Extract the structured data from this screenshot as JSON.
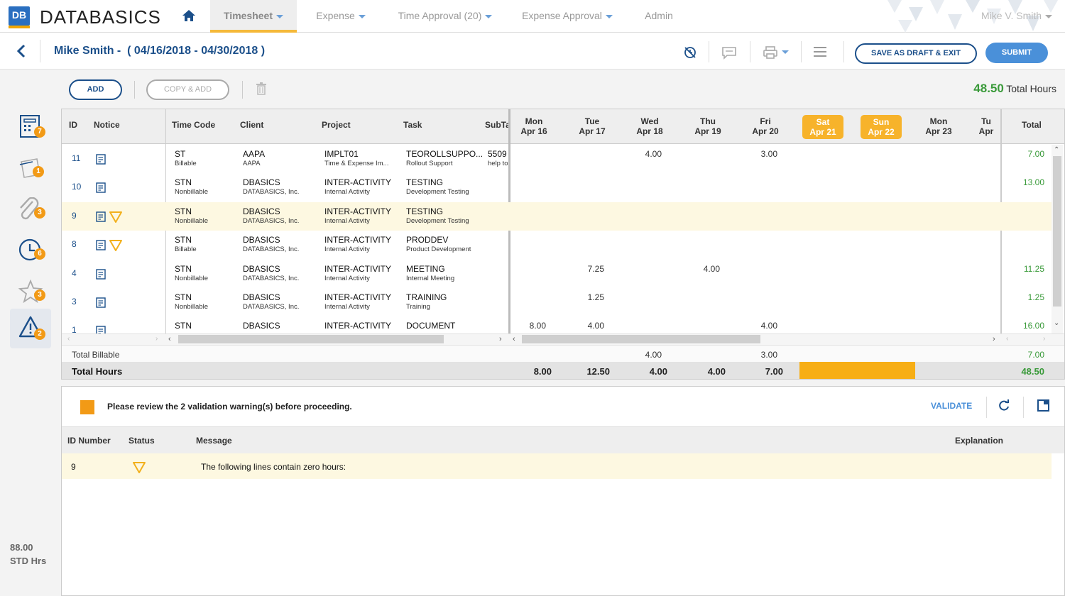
{
  "app": {
    "logo_mark": "DB",
    "logo_text": "DATABASICS"
  },
  "nav": {
    "items": [
      {
        "label": "Timesheet",
        "active": true,
        "dropdown": true
      },
      {
        "label": "Expense",
        "active": false,
        "dropdown": true
      },
      {
        "label": "Time Approval (20)",
        "active": false,
        "dropdown": true
      },
      {
        "label": "Expense Approval",
        "active": false,
        "dropdown": true
      },
      {
        "label": "Admin",
        "active": false,
        "dropdown": false
      }
    ],
    "user": "Mike V. Smith"
  },
  "header": {
    "employee": "Mike Smith -",
    "period": "( 04/16/2018 - 04/30/2018 )",
    "save_draft": "SAVE AS DRAFT & EXIT",
    "submit": "SUBMIT"
  },
  "toolbar": {
    "add": "ADD",
    "copy_add": "COPY & ADD",
    "total_hours_value": "48.50",
    "total_hours_label": "Total Hours"
  },
  "sidebar": {
    "items": [
      {
        "icon": "timesheet-icon",
        "badge": "7"
      },
      {
        "icon": "notes-icon",
        "badge": "1"
      },
      {
        "icon": "attachment-icon",
        "badge": "3"
      },
      {
        "icon": "clock-icon",
        "badge": "6"
      },
      {
        "icon": "star-icon",
        "badge": "3"
      },
      {
        "icon": "warning-icon",
        "badge": "2"
      }
    ],
    "std_hours": "88.00",
    "std_label": "STD Hrs"
  },
  "grid": {
    "left_headers": [
      "ID",
      "Notice"
    ],
    "mid_headers": [
      "Time Code",
      "Client",
      "Project",
      "Task",
      "SubTa"
    ],
    "days": [
      {
        "dow": "Mon",
        "date": "Apr 16",
        "weekend": false
      },
      {
        "dow": "Tue",
        "date": "Apr 17",
        "weekend": false
      },
      {
        "dow": "Wed",
        "date": "Apr 18",
        "weekend": false
      },
      {
        "dow": "Thu",
        "date": "Apr 19",
        "weekend": false
      },
      {
        "dow": "Fri",
        "date": "Apr 20",
        "weekend": false
      },
      {
        "dow": "Sat",
        "date": "Apr 21",
        "weekend": true
      },
      {
        "dow": "Sun",
        "date": "Apr 22",
        "weekend": true
      },
      {
        "dow": "Mon",
        "date": "Apr 23",
        "weekend": false
      },
      {
        "dow": "Tu",
        "date": "Apr",
        "weekend": false
      }
    ],
    "total_header": "Total",
    "rows": [
      {
        "id": "11",
        "warn": false,
        "hl": false,
        "tc": "ST",
        "tc_sub": "Billable",
        "client": "AAPA",
        "client_sub": "AAPA",
        "project": "IMPLT01",
        "project_sub": "Time & Expense Im...",
        "task": "TEOROLLSUPPO...",
        "task_sub": "Rollout Support",
        "subtask": "5509",
        "subtask_sub": "help to",
        "hours": [
          "",
          "",
          "4.00",
          "",
          "3.00",
          "",
          "",
          "",
          ""
        ],
        "total": "7.00"
      },
      {
        "id": "10",
        "warn": false,
        "hl": false,
        "tc": "STN",
        "tc_sub": "Nonbillable",
        "client": "DBASICS",
        "client_sub": "DATABASICS, Inc.",
        "project": "INTER-ACTIVITY",
        "project_sub": "Internal Activity",
        "task": "TESTING",
        "task_sub": "Development Testing",
        "subtask": "",
        "subtask_sub": "",
        "hours": [
          "",
          "",
          "",
          "",
          "",
          "",
          "",
          "",
          ""
        ],
        "total": "13.00"
      },
      {
        "id": "9",
        "warn": true,
        "hl": true,
        "tc": "STN",
        "tc_sub": "Nonbillable",
        "client": "DBASICS",
        "client_sub": "DATABASICS, Inc.",
        "project": "INTER-ACTIVITY",
        "project_sub": "Internal Activity",
        "task": "TESTING",
        "task_sub": "Development Testing",
        "subtask": "",
        "subtask_sub": "",
        "hours": [
          "",
          "",
          "",
          "",
          "",
          "",
          "",
          "",
          ""
        ],
        "total": ""
      },
      {
        "id": "8",
        "warn": true,
        "hl": false,
        "tc": "STN",
        "tc_sub": "Billable",
        "client": "DBASICS",
        "client_sub": "DATABASICS, Inc.",
        "project": "INTER-ACTIVITY",
        "project_sub": "Internal Activity",
        "task": "PRODDEV",
        "task_sub": "Product Development",
        "subtask": "",
        "subtask_sub": "",
        "hours": [
          "",
          "",
          "",
          "",
          "",
          "",
          "",
          "",
          ""
        ],
        "total": ""
      },
      {
        "id": "4",
        "warn": false,
        "hl": false,
        "tc": "STN",
        "tc_sub": "Nonbillable",
        "client": "DBASICS",
        "client_sub": "DATABASICS, Inc.",
        "project": "INTER-ACTIVITY",
        "project_sub": "Internal Activity",
        "task": "MEETING",
        "task_sub": "Internal Meeting",
        "subtask": "",
        "subtask_sub": "",
        "hours": [
          "",
          "7.25",
          "",
          "4.00",
          "",
          "",
          "",
          "",
          ""
        ],
        "total": "11.25"
      },
      {
        "id": "3",
        "warn": false,
        "hl": false,
        "tc": "STN",
        "tc_sub": "Nonbillable",
        "client": "DBASICS",
        "client_sub": "DATABASICS, Inc.",
        "project": "INTER-ACTIVITY",
        "project_sub": "Internal Activity",
        "task": "TRAINING",
        "task_sub": "Training",
        "subtask": "",
        "subtask_sub": "",
        "hours": [
          "",
          "1.25",
          "",
          "",
          "",
          "",
          "",
          "",
          ""
        ],
        "total": "1.25"
      },
      {
        "id": "1",
        "warn": false,
        "hl": false,
        "tc": "STN",
        "tc_sub": "",
        "client": "DBASICS",
        "client_sub": "",
        "project": "INTER-ACTIVITY",
        "project_sub": "",
        "task": "DOCUMENT",
        "task_sub": "",
        "subtask": "",
        "subtask_sub": "",
        "hours": [
          "8.00",
          "4.00",
          "",
          "",
          "4.00",
          "",
          "",
          "",
          ""
        ],
        "total": "16.00"
      }
    ],
    "total_billable_label": "Total Billable",
    "total_billable": [
      "",
      "",
      "4.00",
      "",
      "3.00",
      "",
      "",
      "",
      ""
    ],
    "total_billable_sum": "7.00",
    "total_hours_label": "Total Hours",
    "total_hours": [
      "8.00",
      "12.50",
      "4.00",
      "4.00",
      "7.00",
      "",
      "",
      "",
      ""
    ],
    "total_hours_sum": "48.50"
  },
  "validation": {
    "message": "Please review the 2 validation warning(s) before proceeding.",
    "validate": "VALIDATE",
    "headers": [
      "ID Number",
      "Status",
      "Message",
      "Explanation"
    ],
    "rows": [
      {
        "id": "9",
        "message": "The following lines contain zero hours:"
      }
    ]
  },
  "colors": {
    "brand": "#1b4f8a",
    "accent": "#f7b32b",
    "green": "#3a9a3a",
    "highlight": "#fdf8e1"
  }
}
